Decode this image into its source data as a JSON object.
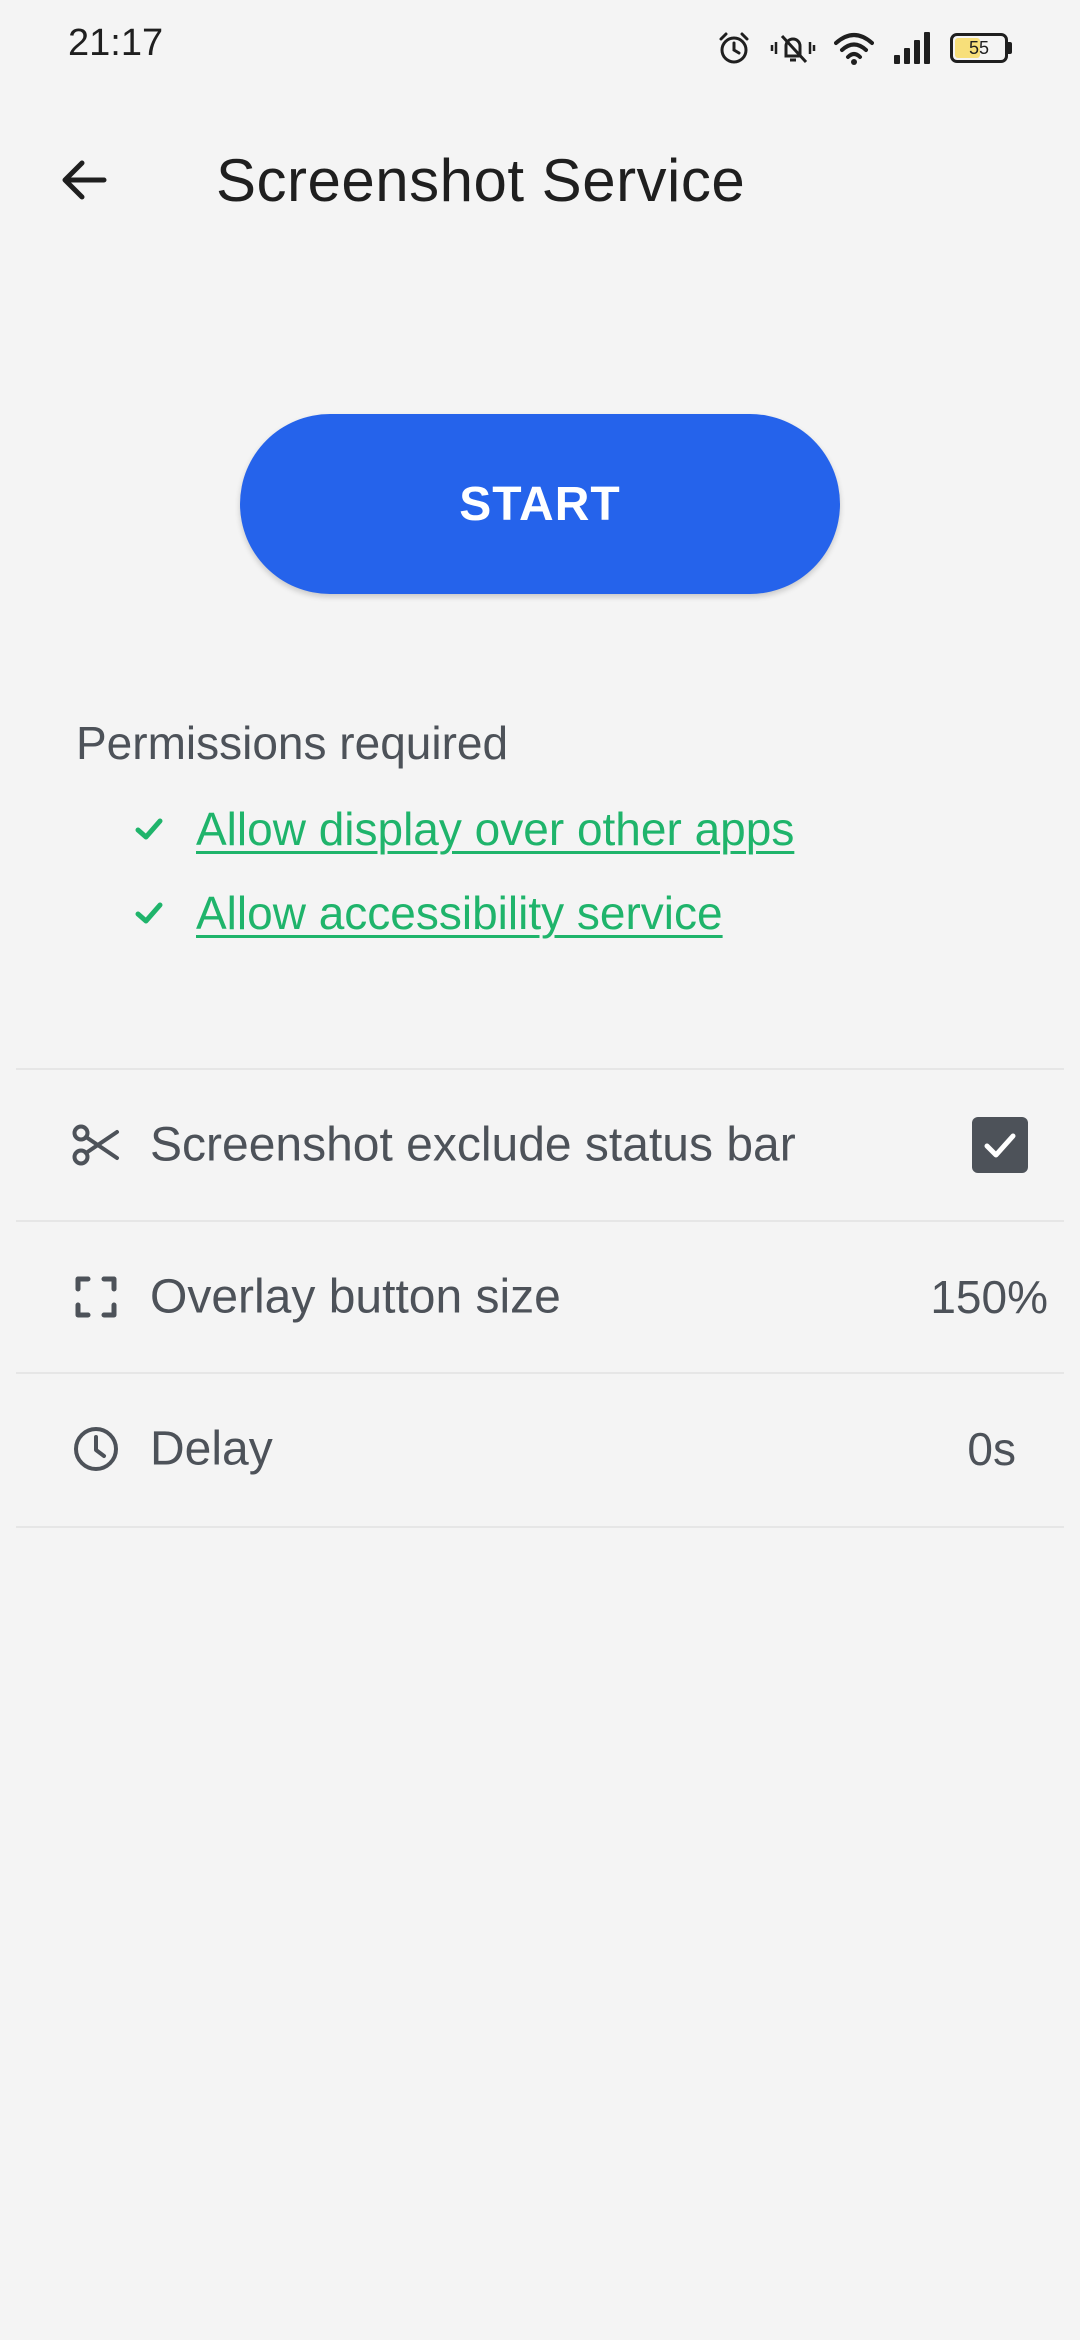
{
  "status_bar": {
    "time": "21:17",
    "battery_level": 55,
    "battery_text": "55",
    "icons": [
      "alarm-icon",
      "vibrate-mute-icon",
      "wifi-icon",
      "signal-icon",
      "battery-icon"
    ]
  },
  "app_bar": {
    "title": "Screenshot Service",
    "back_icon": "back-arrow-icon"
  },
  "start_button": {
    "label": "START",
    "color": "#2563eb"
  },
  "permissions": {
    "title": "Permissions required",
    "items": [
      {
        "label": "Allow display over other apps",
        "granted": true,
        "icon": "check-icon"
      },
      {
        "label": "Allow accessibility service",
        "granted": true,
        "icon": "check-icon"
      }
    ],
    "link_color": "#1fb46b"
  },
  "settings": {
    "items": [
      {
        "icon": "scissors-icon",
        "label": "Screenshot exclude status bar",
        "checked": true
      },
      {
        "icon": "fullscreen-frame-icon",
        "label": "Overlay button size",
        "value": "150%"
      },
      {
        "icon": "clock-icon",
        "label": "Delay",
        "value": "0s"
      }
    ]
  }
}
